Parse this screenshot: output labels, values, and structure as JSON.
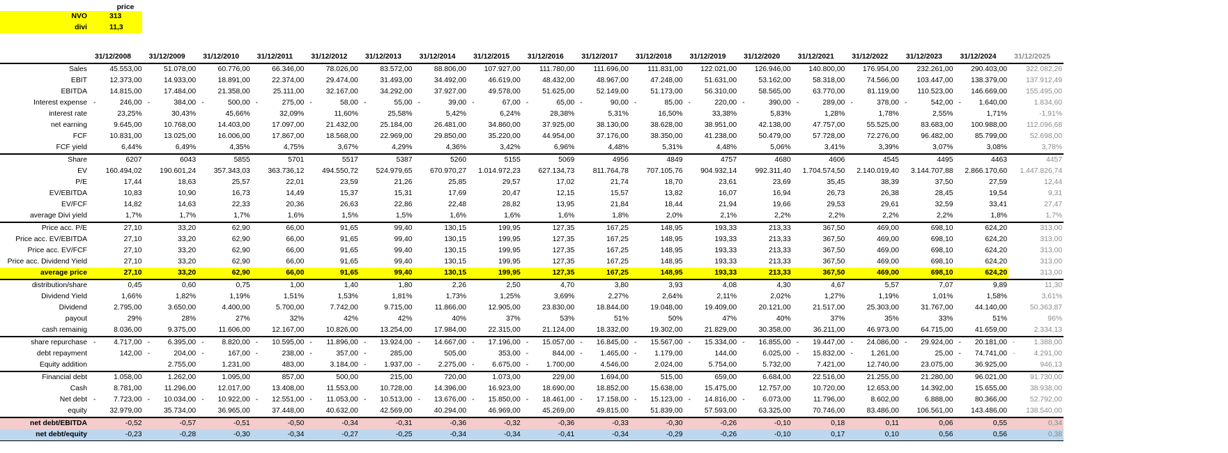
{
  "header": {
    "price_label": "price",
    "ticker_label": "NVO",
    "ticker_value": "313",
    "divi_label": "divi",
    "divi_value": "11,3"
  },
  "years": [
    "31/12/2008",
    "31/12/2009",
    "31/12/2010",
    "31/12/2011",
    "31/12/2012",
    "31/12/2013",
    "31/12/2014",
    "31/12/2015",
    "31/12/2016",
    "31/12/2017",
    "31/12/2018",
    "31/12/2019",
    "31/12/2020",
    "31/12/2021",
    "31/12/2022",
    "31/12/2023",
    "31/12/2024",
    "31/12/2025"
  ],
  "colors": {
    "highlight": "#ffff00",
    "pink": "#f4cccc",
    "blue": "#bdd7ee",
    "projection_text": "#8a8a8a"
  },
  "rows": [
    {
      "label": "Sales",
      "values": [
        "45.553,00",
        "51.078,00",
        "60.776,00",
        "66.346,00",
        "78.026,00",
        "83.572,00",
        "88.806,00",
        "107.927,00",
        "111.780,00",
        "111.696,00",
        "111.831,00",
        "122.021,00",
        "126.946,00",
        "140.800,00",
        "176.954,00",
        "232.261,00",
        "290.403,00",
        "322.082,26"
      ]
    },
    {
      "label": "EBIT",
      "values": [
        "12.373,00",
        "14.933,00",
        "18.891,00",
        "22.374,00",
        "29.474,00",
        "31.493,00",
        "34.492,00",
        "46.619,00",
        "48.432,00",
        "48.967,00",
        "47.248,00",
        "51.631,00",
        "53.162,00",
        "58.318,00",
        "74.566,00",
        "103.447,00",
        "138.379,00",
        "137.912,49"
      ]
    },
    {
      "label": "EBITDA",
      "values": [
        "14.815,00",
        "17.484,00",
        "21.358,00",
        "25.111,00",
        "32.167,00",
        "34.292,00",
        "37.927,00",
        "49.578,00",
        "51.625,00",
        "52.149,00",
        "51.173,00",
        "56.310,00",
        "58.565,00",
        "63.770,00",
        "81.119,00",
        "110.523,00",
        "146.669,00",
        "155.495,00"
      ]
    },
    {
      "label": "Interest expense",
      "values": [
        "246,00",
        "384,00",
        "500,00",
        "275,00",
        "58,00",
        "55,00",
        "39,00",
        "67,00",
        "65,00",
        "90,00",
        "85,00",
        "220,00",
        "390,00",
        "289,00",
        "378,00",
        "542,00",
        "1.640,00",
        "1.834,60"
      ],
      "neg": [
        true,
        true,
        true,
        true,
        true,
        true,
        true,
        true,
        true,
        true,
        true,
        true,
        true,
        true,
        true,
        true,
        true,
        false
      ]
    },
    {
      "label": "interest rate",
      "values": [
        "23,25%",
        "30,43%",
        "45,66%",
        "32,09%",
        "11,60%",
        "25,58%",
        "5,42%",
        "6,24%",
        "28,38%",
        "5,31%",
        "16,50%",
        "33,38%",
        "5,83%",
        "1,28%",
        "1,78%",
        "2,55%",
        "1,71%",
        "-1,91%"
      ]
    },
    {
      "label": "net earning",
      "values": [
        "9.645,00",
        "10.768,00",
        "14.403,00",
        "17.097,00",
        "21.432,00",
        "25.184,00",
        "26.481,00",
        "34.860,00",
        "37.925,00",
        "38.130,00",
        "38.628,00",
        "38.951,00",
        "42.138,00",
        "47.757,00",
        "55.525,00",
        "83.683,00",
        "100.988,00",
        "112.096,68"
      ]
    },
    {
      "label": "FCF",
      "values": [
        "10.831,00",
        "13.025,00",
        "16.006,00",
        "17.867,00",
        "18.568,00",
        "22.969,00",
        "29.850,00",
        "35.220,00",
        "44.954,00",
        "37.176,00",
        "38.350,00",
        "41.238,00",
        "50.479,00",
        "57.728,00",
        "72.276,00",
        "96.482,00",
        "85.799,00",
        "52.698,00"
      ]
    },
    {
      "label": "FCF yield",
      "values": [
        "6,44%",
        "6,49%",
        "4,35%",
        "4,75%",
        "3,67%",
        "4,29%",
        "4,36%",
        "3,42%",
        "6,96%",
        "4,48%",
        "5,31%",
        "4,48%",
        "5,06%",
        "3,41%",
        "3,39%",
        "3,07%",
        "3,08%",
        "3,78%"
      ]
    },
    {
      "label": "Share",
      "sep": true,
      "values": [
        "6207",
        "6043",
        "5855",
        "5701",
        "5517",
        "5387",
        "5260",
        "5155",
        "5069",
        "4956",
        "4849",
        "4757",
        "4680",
        "4606",
        "4545",
        "4495",
        "4463",
        "4457"
      ]
    },
    {
      "label": "EV",
      "values": [
        "160.494,02",
        "190.601,24",
        "357.343,03",
        "363.736,12",
        "494.550,72",
        "524.979,65",
        "670.970,27",
        "1.014.972,23",
        "627.134,73",
        "811.764,78",
        "707.105,76",
        "904.932,14",
        "992.311,40",
        "1.704.574,50",
        "2.140.019,40",
        "3.144.707,88",
        "2.866.170,60",
        "1.447.826,74"
      ]
    },
    {
      "label": "P/E",
      "values": [
        "17,44",
        "18,63",
        "25,57",
        "22,01",
        "23,59",
        "21,26",
        "25,85",
        "29,57",
        "17,02",
        "21,74",
        "18,70",
        "23,61",
        "23,69",
        "35,45",
        "38,39",
        "37,50",
        "27,59",
        "12,44"
      ]
    },
    {
      "label": "EV/EBITDA",
      "values": [
        "10,83",
        "10,90",
        "16,73",
        "14,49",
        "15,37",
        "15,31",
        "17,69",
        "20,47",
        "12,15",
        "15,57",
        "13,82",
        "16,07",
        "16,94",
        "26,73",
        "26,38",
        "28,45",
        "19,54",
        "9,31"
      ]
    },
    {
      "label": "EV/FCF",
      "values": [
        "14,82",
        "14,63",
        "22,33",
        "20,36",
        "26,63",
        "22,86",
        "22,48",
        "28,82",
        "13,95",
        "21,84",
        "18,44",
        "21,94",
        "19,66",
        "29,53",
        "29,61",
        "32,59",
        "33,41",
        "27,47"
      ]
    },
    {
      "label": "average Divi yield",
      "values": [
        "1,7%",
        "1,7%",
        "1,7%",
        "1,6%",
        "1,5%",
        "1,5%",
        "1,6%",
        "1,6%",
        "1,6%",
        "1,8%",
        "2,0%",
        "2,1%",
        "2,2%",
        "2,2%",
        "2,2%",
        "2,2%",
        "1,8%",
        "1,7%"
      ]
    },
    {
      "label": "Price acc. P/E",
      "sep": true,
      "values": [
        "27,10",
        "33,20",
        "62,90",
        "66,00",
        "91,65",
        "99,40",
        "130,15",
        "199,95",
        "127,35",
        "167,25",
        "148,95",
        "193,33",
        "213,33",
        "367,50",
        "469,00",
        "698,10",
        "624,20",
        "313,00"
      ]
    },
    {
      "label": "Price acc. EV/EBITDA",
      "values": [
        "27,10",
        "33,20",
        "62,90",
        "66,00",
        "91,65",
        "99,40",
        "130,15",
        "199,95",
        "127,35",
        "167,25",
        "148,95",
        "193,33",
        "213,33",
        "367,50",
        "469,00",
        "698,10",
        "624,20",
        "313,00"
      ]
    },
    {
      "label": "Price acc. EV/FCF",
      "values": [
        "27,10",
        "33,20",
        "62,90",
        "66,00",
        "91,65",
        "99,40",
        "130,15",
        "199,95",
        "127,35",
        "167,25",
        "148,95",
        "193,33",
        "213,33",
        "367,50",
        "469,00",
        "698,10",
        "624,20",
        "313,00"
      ]
    },
    {
      "label": "Price acc. Dividend Yield",
      "values": [
        "27,10",
        "33,20",
        "62,90",
        "66,00",
        "91,65",
        "99,40",
        "130,15",
        "199,95",
        "127,35",
        "167,25",
        "148,95",
        "193,33",
        "213,33",
        "367,50",
        "469,00",
        "698,10",
        "624,20",
        "313,00"
      ]
    },
    {
      "label": "average price",
      "style": "avg",
      "values": [
        "27,10",
        "33,20",
        "62,90",
        "66,00",
        "91,65",
        "99,40",
        "130,15",
        "199,95",
        "127,35",
        "167,25",
        "148,95",
        "193,33",
        "213,33",
        "367,50",
        "469,00",
        "698,10",
        "624,20",
        "313,00"
      ]
    },
    {
      "label": "distribution/share",
      "sep": true,
      "values": [
        "0,45",
        "0,60",
        "0,75",
        "1,00",
        "1,40",
        "1,80",
        "2,26",
        "2,50",
        "4,70",
        "3,80",
        "3,93",
        "4,08",
        "4,30",
        "4,67",
        "5,57",
        "7,07",
        "9,89",
        "11,30"
      ]
    },
    {
      "label": "Dividend Yield",
      "values": [
        "1,66%",
        "1,82%",
        "1,19%",
        "1,51%",
        "1,53%",
        "1,81%",
        "1,73%",
        "1,25%",
        "3,69%",
        "2,27%",
        "2,64%",
        "2,11%",
        "2,02%",
        "1,27%",
        "1,19%",
        "1,01%",
        "1,58%",
        "3,61%"
      ]
    },
    {
      "label": "Dividend",
      "values": [
        "2.795,00",
        "3.650,00",
        "4.400,00",
        "5.700,00",
        "7.742,00",
        "9.715,00",
        "11.866,00",
        "12.905,00",
        "23.830,00",
        "18.844,00",
        "19.048,00",
        "19.409,00",
        "20.121,00",
        "21.517,00",
        "25.303,00",
        "31.767,00",
        "44.140,00",
        "50.363,87"
      ]
    },
    {
      "label": "payout",
      "values": [
        "29%",
        "28%",
        "27%",
        "32%",
        "42%",
        "42%",
        "40%",
        "37%",
        "53%",
        "51%",
        "50%",
        "47%",
        "40%",
        "37%",
        "35%",
        "33%",
        "51%",
        "96%"
      ]
    },
    {
      "label": "cash remainig",
      "values": [
        "8.036,00",
        "9.375,00",
        "11.606,00",
        "12.167,00",
        "10.826,00",
        "13.254,00",
        "17.984,00",
        "22.315,00",
        "21.124,00",
        "18.332,00",
        "19.302,00",
        "21.829,00",
        "30.358,00",
        "36.211,00",
        "46.973,00",
        "64.715,00",
        "41.659,00",
        "2.334,13"
      ]
    },
    {
      "label": "share repurchase",
      "sep": true,
      "values": [
        "4.717,00",
        "6.395,00",
        "8.820,00",
        "10.595,00",
        "11.896,00",
        "13.924,00",
        "14.667,00",
        "17.196,00",
        "15.057,00",
        "16.845,00",
        "15.567,00",
        "15.334,00",
        "16.855,00",
        "19.447,00",
        "24.086,00",
        "29.924,00",
        "20.181,00",
        "1.388,00"
      ],
      "neg": [
        true,
        true,
        true,
        true,
        true,
        true,
        true,
        true,
        true,
        true,
        true,
        true,
        true,
        true,
        true,
        true,
        true,
        true
      ]
    },
    {
      "label": "debt repayment",
      "values": [
        "142,00",
        "204,00",
        "167,00",
        "238,00",
        "357,00",
        "285,00",
        "505,00",
        "353,00",
        "844,00",
        "1.465,00",
        "1.179,00",
        "144,00",
        "6.025,00",
        "15.832,00",
        "1.261,00",
        "25,00",
        "74.741,00",
        "4.291,00"
      ],
      "neg": [
        false,
        true,
        true,
        true,
        true,
        true,
        false,
        false,
        true,
        true,
        true,
        false,
        false,
        true,
        true,
        false,
        true,
        true
      ]
    },
    {
      "label": "Equity addition",
      "values": [
        "",
        "2.755,00",
        "1.231,00",
        "483,00",
        "3.184,00",
        "1.937,00",
        "2.275,00",
        "6.675,00",
        "1.700,00",
        "4.546,00",
        "2.024,00",
        "5.754,00",
        "5.732,00",
        "7.421,00",
        "12.740,00",
        "23.075,00",
        "36.925,00",
        "946,13"
      ],
      "neg": [
        false,
        false,
        false,
        false,
        false,
        true,
        true,
        true,
        true,
        false,
        false,
        false,
        false,
        false,
        false,
        false,
        false,
        false
      ]
    },
    {
      "label": "Financial debt",
      "sep": true,
      "values": [
        "1.058,00",
        "1.262,00",
        "1.095,00",
        "857,00",
        "500,00",
        "215,00",
        "720,00",
        "1.073,00",
        "229,00",
        "1.694,00",
        "515,00",
        "659,00",
        "6.684,00",
        "22.516,00",
        "21.255,00",
        "21.280,00",
        "96.021,00",
        "91.730,00"
      ]
    },
    {
      "label": "Cash",
      "values": [
        "8.781,00",
        "11.296,00",
        "12.017,00",
        "13.408,00",
        "11.553,00",
        "10.728,00",
        "14.396,00",
        "16.923,00",
        "18.690,00",
        "18.852,00",
        "15.638,00",
        "15.475,00",
        "12.757,00",
        "10.720,00",
        "12.653,00",
        "14.392,00",
        "15.655,00",
        "38.938,00"
      ]
    },
    {
      "label": "Net debt",
      "values": [
        "7.723,00",
        "10.034,00",
        "10.922,00",
        "12.551,00",
        "11.053,00",
        "10.513,00",
        "13.676,00",
        "15.850,00",
        "18.461,00",
        "17.158,00",
        "15.123,00",
        "14.816,00",
        "6.073,00",
        "11.796,00",
        "8.602,00",
        "6.888,00",
        "80.366,00",
        "52.792,00"
      ],
      "neg": [
        true,
        true,
        true,
        true,
        true,
        true,
        true,
        true,
        true,
        true,
        true,
        true,
        true,
        false,
        false,
        false,
        false,
        false
      ]
    },
    {
      "label": "equity",
      "values": [
        "32.979,00",
        "35.734,00",
        "36.965,00",
        "37.448,00",
        "40.632,00",
        "42.569,00",
        "40.294,00",
        "46.969,00",
        "45.269,00",
        "49.815,00",
        "51.839,00",
        "57.593,00",
        "63.325,00",
        "70.746,00",
        "83.486,00",
        "106.561,00",
        "143.486,00",
        "138.540,00"
      ]
    },
    {
      "label": "net debt/EBITDA",
      "style": "pink",
      "sep": true,
      "values": [
        "-0,52",
        "-0,57",
        "-0,51",
        "-0,50",
        "-0,34",
        "-0,31",
        "-0,36",
        "-0,32",
        "-0,36",
        "-0,33",
        "-0,30",
        "-0,26",
        "-0,10",
        "0,18",
        "0,11",
        "0,06",
        "0,55",
        "0,34"
      ]
    },
    {
      "label": "net debt/equity",
      "style": "blue",
      "values": [
        "-0,23",
        "-0,28",
        "-0,30",
        "-0,34",
        "-0,27",
        "-0,25",
        "-0,34",
        "-0,34",
        "-0,41",
        "-0,34",
        "-0,29",
        "-0,26",
        "-0,10",
        "0,17",
        "0,10",
        "0,56",
        "0,56",
        "0,38"
      ]
    }
  ]
}
